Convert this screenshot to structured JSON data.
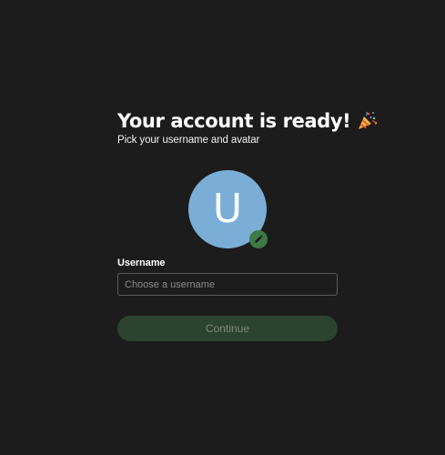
{
  "header": {
    "title": "Your account is ready!",
    "title_emoji_icon": "party-popper-icon",
    "subtitle": "Pick your username and avatar"
  },
  "avatar": {
    "initial": "U",
    "background_color": "#7aaed6",
    "edit_icon": "pencil-icon",
    "edit_badge_color": "#3d7a45"
  },
  "form": {
    "username_label": "Username",
    "username_value": "",
    "username_placeholder": "Choose a username",
    "continue_label": "Continue"
  },
  "colors": {
    "background": "#1c1c1c",
    "button_disabled_bg": "#2b4431",
    "button_disabled_text": "#7d8a7f"
  }
}
